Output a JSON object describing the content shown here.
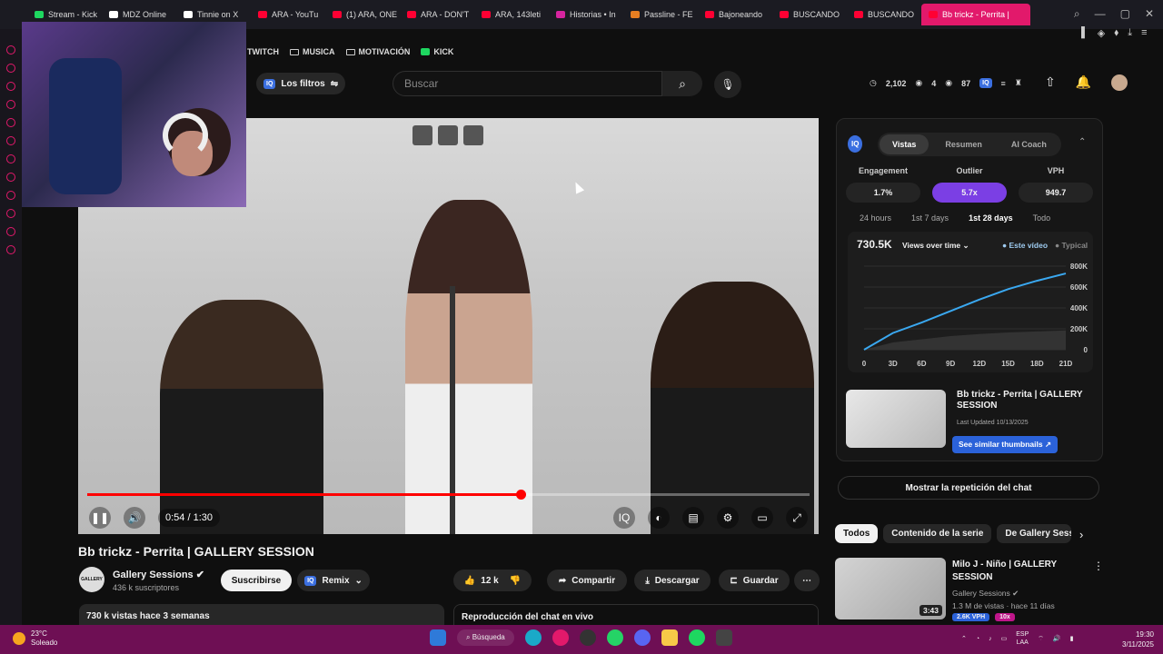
{
  "browser": {
    "tabs": [
      {
        "label": "Stream - Kick",
        "icon": "kick-icon"
      },
      {
        "label": "MDZ Online",
        "icon": "x-icon"
      },
      {
        "label": "Tinnie on X",
        "icon": "x-icon"
      },
      {
        "label": "ARA - YouTu",
        "icon": "youtube-icon"
      },
      {
        "label": "(1) ARA, ONE",
        "icon": "youtube-icon"
      },
      {
        "label": "ARA - DON'T",
        "icon": "youtube-icon"
      },
      {
        "label": "ARA, 143leti",
        "icon": "youtube-icon"
      },
      {
        "label": "Historias • In",
        "icon": "instagram-icon"
      },
      {
        "label": "Passline - FE",
        "icon": "passline-icon"
      },
      {
        "label": "Bajoneando",
        "icon": "youtube-icon"
      },
      {
        "label": "BUSCANDO",
        "icon": "youtube-icon"
      },
      {
        "label": "BUSCANDO",
        "icon": "youtube-icon"
      },
      {
        "label": "Bb trickz - Perrita |",
        "icon": "youtube-icon",
        "active": true
      }
    ],
    "bookmarks": [
      "TWITCH",
      "MUSICA",
      "MOTIVACIÓN",
      "KICK"
    ]
  },
  "header": {
    "filters_label": "Los filtros",
    "search_placeholder": "Buscar",
    "stats": [
      "2,102",
      "4",
      "87"
    ]
  },
  "video": {
    "current_time": "0:54 / 1:30",
    "progress": 0.6,
    "title": "Bb trickz - Perrita | GALLERY SESSION",
    "channel": "Gallery Sessions",
    "channel_avatar_text": "GALLERY",
    "subscribers": "436 k suscriptores",
    "subscribe_label": "Suscribirse",
    "remix_label": "Remix",
    "likes": "12 k",
    "share_label": "Compartir",
    "download_label": "Descargar",
    "save_label": "Guardar",
    "views_line": "730 k vistas  hace 3 semanas",
    "chat_label": "Reproducción del chat en vivo"
  },
  "panel": {
    "tabs": [
      "Vistas",
      "Resumen",
      "AI Coach"
    ],
    "metrics": [
      {
        "label": "Engagement",
        "value": "1.7%"
      },
      {
        "label": "Outlier",
        "value": "5.7x"
      },
      {
        "label": "VPH",
        "value": "949.7"
      }
    ],
    "ranges": [
      "24 hours",
      "1st 7 days",
      "1st 28 days",
      "Todo"
    ],
    "total_views": "730.5K",
    "views_select": "Views over time",
    "legend_this": "Este vídeo",
    "legend_typical": "Typical",
    "thumb_title": "Bb trickz - Perrita | GALLERY SESSION",
    "thumb_updated": "Last Updated 10/13/2025",
    "similar_label": "See similar thumbnails"
  },
  "chart_data": {
    "type": "line",
    "x": [
      "0",
      "3D",
      "6D",
      "9D",
      "12D",
      "15D",
      "18D",
      "21D"
    ],
    "y_ticks": [
      "800K",
      "600K",
      "400K",
      "200K",
      "0"
    ],
    "ylim": [
      0,
      800000
    ],
    "series": [
      {
        "name": "Este vídeo",
        "values": [
          0,
          160000,
          260000,
          370000,
          480000,
          580000,
          660000,
          730000
        ]
      },
      {
        "name": "Typical",
        "values": [
          0,
          70000,
          100000,
          130000,
          150000,
          165000,
          175000,
          185000
        ]
      }
    ]
  },
  "sidebar": {
    "chat_replay_label": "Mostrar la repetición del chat",
    "chips": [
      "Todos",
      "Contenido de la serie",
      "De Gallery Sess"
    ],
    "reco": {
      "title": "Milo J - Niño | GALLERY SESSION",
      "channel": "Gallery Sessions",
      "meta": "1.3 M de vistas · hace 11 días",
      "duration": "3:43",
      "vph": "2.6K VPH",
      "mult": "10x"
    }
  },
  "taskbar": {
    "temp": "23°C",
    "weather": "Soleado",
    "search_label": "Búsqueda",
    "lang": "ESP",
    "lang2": "LAA",
    "time": "19:30",
    "date": "3/11/2025"
  }
}
